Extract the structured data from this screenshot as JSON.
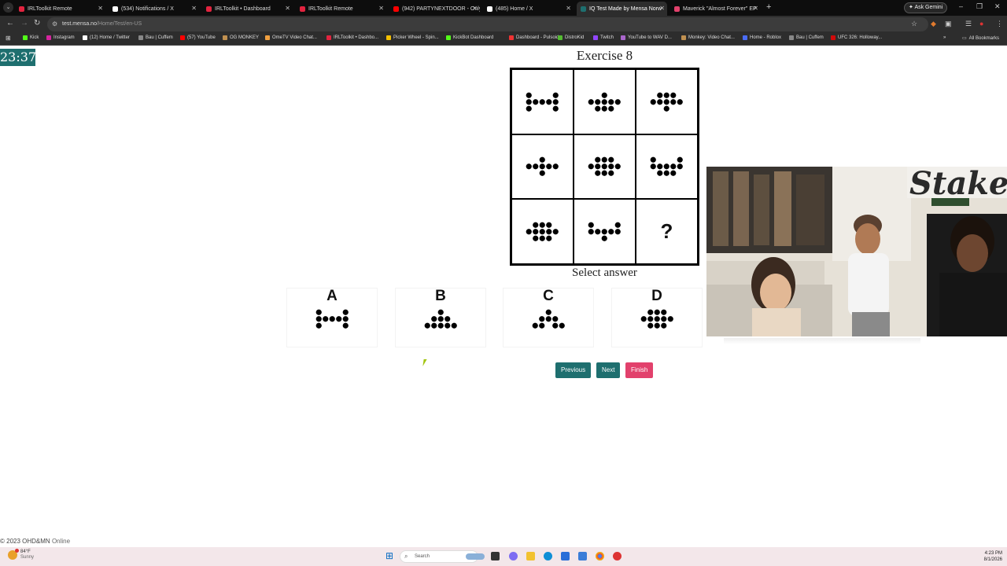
{
  "browser": {
    "tabs": [
      {
        "title": "IRLToolkit Remote",
        "color": "#e2233f",
        "active": false
      },
      {
        "title": "(534) Notifications / X",
        "color": "#ffffff",
        "active": false
      },
      {
        "title": "IRLToolkit • Dashboard",
        "color": "#e2233f",
        "active": false
      },
      {
        "title": "IRLToolkit Remote",
        "color": "#e2233f",
        "active": false
      },
      {
        "title": "(942) PARTYNEXTDOOR - Only",
        "color": "#ff0000",
        "active": false
      },
      {
        "title": "(485) Home / X",
        "color": "#ffffff",
        "active": false
      },
      {
        "title": "IQ Test Made by Mensa Norw",
        "color": "#1e6f6f",
        "active": true
      },
      {
        "title": "Maverick \"Almost Forever\" EP",
        "color": "#e2416c",
        "active": false
      }
    ],
    "ask_gemini": "Ask Gemini",
    "url_host": "test.mensa.no",
    "url_path": "/Home/Test/en-US",
    "bookmarks": [
      {
        "label": "Kick",
        "color": "#53fc18"
      },
      {
        "label": "Instagram",
        "color": "#d6249f"
      },
      {
        "label": "(12) Home / Twitter",
        "color": "#ffffff"
      },
      {
        "label": "Bau | Cuffem",
        "color": "#888888"
      },
      {
        "label": "(57) YouTube",
        "color": "#ff0000"
      },
      {
        "label": "OG MONKEY",
        "color": "#c09050"
      },
      {
        "label": "OmeTV Video Chat...",
        "color": "#f0a040"
      },
      {
        "label": "IRLToolkit • Dashbo...",
        "color": "#e2233f"
      },
      {
        "label": "Picker Wheel - Spin...",
        "color": "#f5c000"
      },
      {
        "label": "KickBot Dashboard",
        "color": "#53fc18"
      },
      {
        "label": "Dashboard - Pulsoid",
        "color": "#e33"
      },
      {
        "label": "DistroKid",
        "color": "#5b3"
      },
      {
        "label": "Twitch",
        "color": "#9146ff"
      },
      {
        "label": "YouTube to WAV D...",
        "color": "#aa66cc"
      },
      {
        "label": "Monkey: Video Chat...",
        "color": "#c09050"
      },
      {
        "label": "Home - Roblox",
        "color": "#4a6cf7"
      },
      {
        "label": "Bau | Cuffem",
        "color": "#888888"
      },
      {
        "label": "UFC 326: Holloway...",
        "color": "#d20a0a"
      }
    ],
    "all_bookmarks": "All Bookmarks"
  },
  "test": {
    "timer": "23:37",
    "title": "Exercise 8",
    "question_mark": "?",
    "select_label": "Select answer",
    "grid_patterns": [
      [
        [
          1,
          0,
          0,
          0,
          1
        ],
        [
          1,
          1,
          1,
          1,
          1
        ],
        [
          1,
          0,
          0,
          0,
          1
        ]
      ],
      [
        [
          0,
          0,
          1,
          0,
          0
        ],
        [
          1,
          1,
          1,
          1,
          1
        ],
        [
          0,
          1,
          1,
          1,
          0
        ]
      ],
      [
        [
          0,
          1,
          1,
          1,
          0
        ],
        [
          1,
          1,
          1,
          1,
          1
        ],
        [
          0,
          0,
          1,
          0,
          0
        ]
      ],
      [
        [
          0,
          0,
          1,
          0,
          0
        ],
        [
          1,
          1,
          1,
          1,
          1
        ],
        [
          0,
          0,
          1,
          0,
          0
        ]
      ],
      [
        [
          0,
          1,
          1,
          1,
          0
        ],
        [
          1,
          1,
          1,
          1,
          1
        ],
        [
          0,
          1,
          1,
          1,
          0
        ]
      ],
      [
        [
          1,
          0,
          0,
          0,
          1
        ],
        [
          1,
          1,
          1,
          1,
          1
        ],
        [
          0,
          1,
          1,
          1,
          0
        ]
      ],
      [
        [
          0,
          1,
          1,
          1,
          0
        ],
        [
          1,
          1,
          1,
          1,
          1
        ],
        [
          0,
          1,
          1,
          1,
          0
        ]
      ],
      [
        [
          1,
          0,
          0,
          0,
          1
        ],
        [
          1,
          1,
          1,
          1,
          1
        ],
        [
          0,
          0,
          1,
          0,
          0
        ]
      ],
      null
    ],
    "options": [
      {
        "letter": "A",
        "pattern": [
          [
            1,
            0,
            0,
            0,
            1
          ],
          [
            1,
            1,
            1,
            1,
            1
          ],
          [
            1,
            0,
            0,
            0,
            1
          ]
        ]
      },
      {
        "letter": "B",
        "pattern": [
          [
            0,
            0,
            1,
            0,
            0
          ],
          [
            0,
            1,
            1,
            1,
            0
          ],
          [
            1,
            1,
            1,
            1,
            1
          ]
        ]
      },
      {
        "letter": "C",
        "pattern": [
          [
            0,
            0,
            1,
            0,
            0
          ],
          [
            0,
            1,
            1,
            1,
            0
          ],
          [
            1,
            1,
            0,
            1,
            1
          ]
        ]
      },
      {
        "letter": "D",
        "pattern": [
          [
            0,
            1,
            1,
            1,
            0
          ],
          [
            1,
            1,
            1,
            1,
            1
          ],
          [
            0,
            1,
            1,
            1,
            0
          ]
        ]
      }
    ],
    "buttons": {
      "previous": "Previous",
      "next": "Next",
      "finish": "Finish"
    },
    "colors": {
      "primary": "#1e6f6f",
      "danger": "#e2416c"
    },
    "footer_copy": "© 2023 OHD&MN",
    "footer_online": "Online"
  },
  "overlay": {
    "brand_text": "Stake"
  },
  "taskbar": {
    "weather_temp": "84°F",
    "weather_desc": "Sunny",
    "search_placeholder": "Search",
    "time": "4:23 PM",
    "date": "8/1/2026"
  }
}
